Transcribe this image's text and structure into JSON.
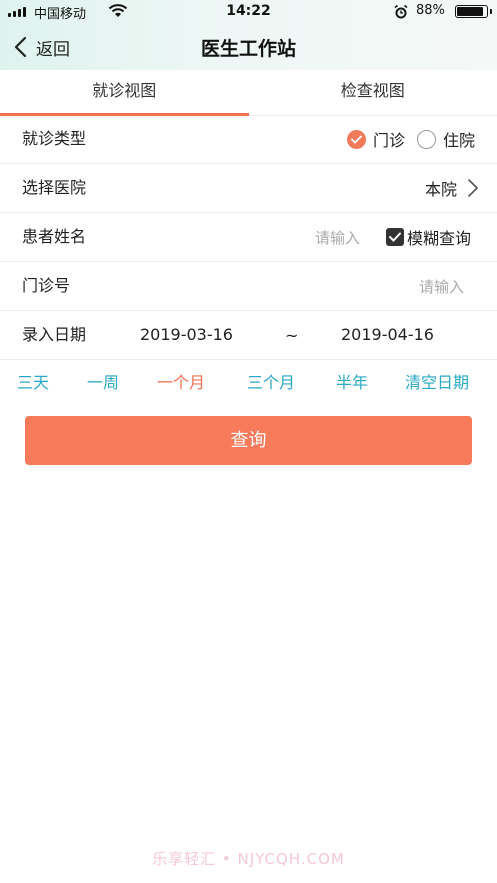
{
  "status_bar": {
    "carrier": "中国移动",
    "time": "14:22",
    "battery": "88%"
  },
  "header": {
    "back_label": "返回",
    "title": "医生工作站"
  },
  "tabs": [
    {
      "label": "就诊视图",
      "active": true
    },
    {
      "label": "检查视图",
      "active": false
    }
  ],
  "form": {
    "visit_type": {
      "label": "就诊类型",
      "options": [
        {
          "label": "门诊",
          "selected": true
        },
        {
          "label": "住院",
          "selected": false
        }
      ]
    },
    "hospital": {
      "label": "选择医院",
      "value": "本院"
    },
    "patient_name": {
      "label": "患者姓名",
      "placeholder": "请输入",
      "fuzzy_label": "模糊查询",
      "fuzzy_checked": true
    },
    "clinic_no": {
      "label": "门诊号",
      "placeholder": "请输入"
    },
    "entry_date": {
      "label": "录入日期",
      "start": "2019-03-16",
      "separator": "~",
      "end": "2019-04-16"
    }
  },
  "quick_ranges": [
    {
      "label": "三天",
      "selected": false
    },
    {
      "label": "一周",
      "selected": false
    },
    {
      "label": "一个月",
      "selected": true
    },
    {
      "label": "三个月",
      "selected": false
    },
    {
      "label": "半年",
      "selected": false
    },
    {
      "label": "清空日期",
      "selected": false
    }
  ],
  "query_button": "查询",
  "watermark": "乐享轻汇 • NJYCQH.COM",
  "colors": {
    "accent": "#f07050",
    "button": "#f77a5a",
    "link": "#2aa9c4"
  }
}
